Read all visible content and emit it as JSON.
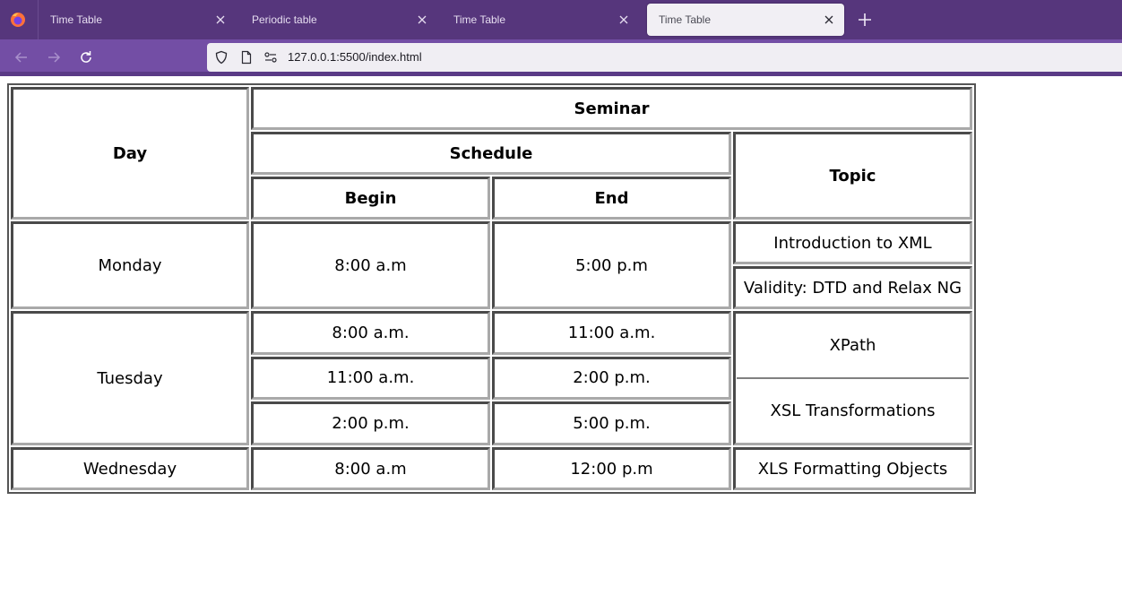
{
  "browser": {
    "tabs": [
      {
        "label": "Time Table",
        "active": false
      },
      {
        "label": "Periodic table",
        "active": false
      },
      {
        "label": "Time Table",
        "active": false
      },
      {
        "label": "Time Table",
        "active": true
      }
    ],
    "url": "127.0.0.1:5500/index.html",
    "accent_color": "#56367c"
  },
  "timetable": {
    "headers": {
      "day": "Day",
      "seminar": "Seminar",
      "schedule": "Schedule",
      "begin": "Begin",
      "end": "End",
      "topic": "Topic"
    },
    "rows": {
      "monday": {
        "day": "Monday",
        "begin": "8:00 a.m",
        "end": "5:00 p.m",
        "topics": [
          "Introduction to XML",
          "Validity: DTD and Relax NG"
        ]
      },
      "tuesday": {
        "day": "Tuesday",
        "slots": [
          {
            "begin": "8:00 a.m.",
            "end": "11:00 a.m."
          },
          {
            "begin": "11:00 a.m.",
            "end": "2:00 p.m."
          },
          {
            "begin": "2:00 p.m.",
            "end": "5:00 p.m."
          }
        ],
        "topics": [
          "XPath",
          "XSL Transformations"
        ]
      },
      "wednesday": {
        "day": "Wednesday",
        "begin": "8:00 a.m",
        "end": "12:00 p.m",
        "topic": "XLS Formatting Objects"
      }
    }
  }
}
